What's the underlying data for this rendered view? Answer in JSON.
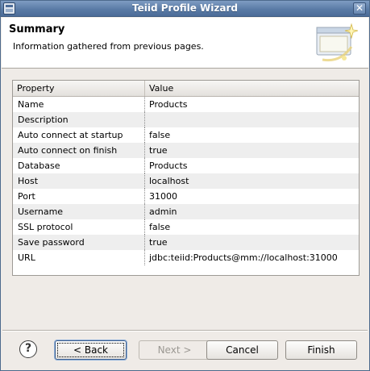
{
  "window": {
    "title": "Teiid Profile Wizard",
    "close_glyph": "✕"
  },
  "banner": {
    "title": "Summary",
    "description": "Information gathered from previous pages.",
    "graphic_icon": "wizard-banner-graphic"
  },
  "table": {
    "columns": [
      "Property",
      "Value"
    ],
    "rows": [
      {
        "property": "Name",
        "value": "Products"
      },
      {
        "property": "Description",
        "value": ""
      },
      {
        "property": "Auto connect at startup",
        "value": "false"
      },
      {
        "property": "Auto connect on finish",
        "value": "true"
      },
      {
        "property": "Database",
        "value": "Products"
      },
      {
        "property": "Host",
        "value": "localhost"
      },
      {
        "property": "Port",
        "value": "31000"
      },
      {
        "property": "Username",
        "value": "admin"
      },
      {
        "property": "SSL protocol",
        "value": "false"
      },
      {
        "property": "Save password",
        "value": "true"
      },
      {
        "property": "URL",
        "value": "jdbc:teiid:Products@mm://localhost:31000"
      }
    ]
  },
  "buttons": {
    "help": "?",
    "back": "< Back",
    "next": "Next >",
    "cancel": "Cancel",
    "finish": "Finish"
  }
}
